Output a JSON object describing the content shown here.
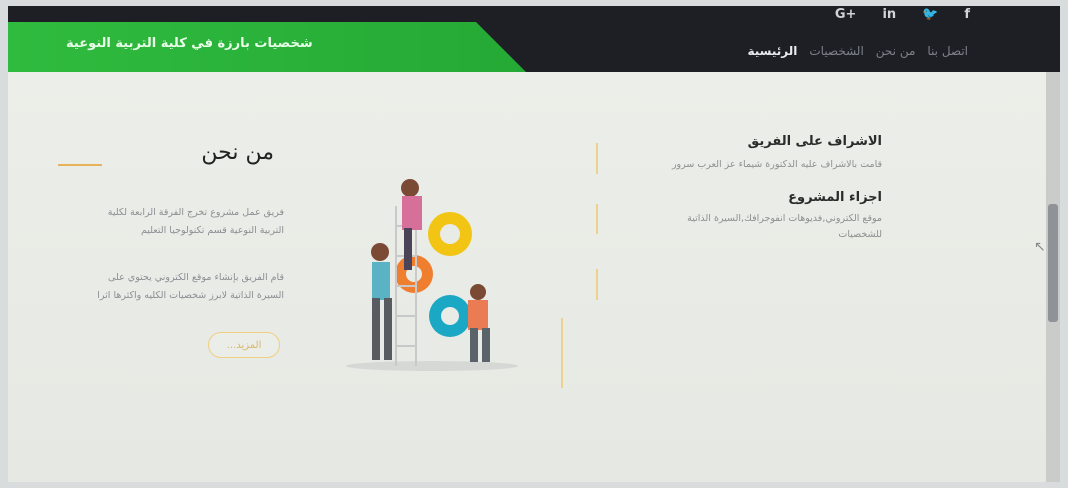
{
  "header": {
    "brand": "شخصيات بارزة في كلية التربية النوعية",
    "social": {
      "facebook": "f",
      "twitter": "🐦",
      "linkedin": "in",
      "google": "G+"
    },
    "nav": [
      "الرئيسية",
      "الشخصيات",
      "من نحن",
      "اتصل بنا"
    ]
  },
  "about": {
    "title": "من نحن",
    "paragraph1": "فريق عمل مشروع تخرج الفرقة الرابعة لكلية التربية النوعية قسم تكنولوجيا التعليم",
    "paragraph2": "قام الفريق بإنشاء موقع الكتروني يحتوي على السيرة الذاتية لابرز شخصيات الكليه واكثرها اثرا",
    "more": "المزيد..."
  },
  "sections": [
    {
      "title": "الاشراف على الفريق",
      "text": "قامت بالاشراف عليه الدكتورة شيماء عز العرب سرور"
    },
    {
      "title": "اجزاء المشروع",
      "text": "موقع الكتروني,فديوهات انفوجرافك,السيرة الذاتية للشخصيات"
    }
  ],
  "colors": {
    "header_dark": "#1d1f24",
    "header_green": "#2fbb3e",
    "accent_orange": "#e7b35a"
  }
}
